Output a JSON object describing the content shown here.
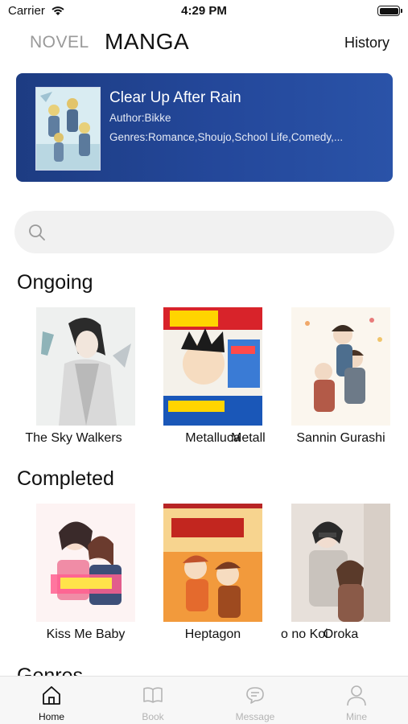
{
  "status_bar": {
    "carrier": "Carrier",
    "time": "4:29 PM"
  },
  "header": {
    "novel_tab": "NOVEL",
    "manga_tab": "MANGA",
    "history_label": "History"
  },
  "banner": {
    "title": "Clear Up After Rain",
    "author": "Author:Bikke",
    "genres": "Genres:Romance,Shoujo,School Life,Comedy,..."
  },
  "search": {
    "placeholder": ""
  },
  "ongoing": {
    "title": "Ongoing",
    "items": [
      {
        "label": "The Sky Walkers"
      },
      {
        "label": "Metalluca"
      },
      {
        "label": "Metall"
      },
      {
        "label": "Sannin Gurashi"
      }
    ]
  },
  "completed": {
    "title": "Completed",
    "items": [
      {
        "label": "Kiss Me Baby"
      },
      {
        "label": "Heptagon"
      },
      {
        "label": "o no Koi"
      },
      {
        "label": "Oroka"
      }
    ]
  },
  "next_section": {
    "title": "Genres"
  },
  "bottom_nav": {
    "items": [
      {
        "label": "Home",
        "icon": "home-icon",
        "active": true
      },
      {
        "label": "Book",
        "icon": "book-icon",
        "active": false
      },
      {
        "label": "Message",
        "icon": "message-icon",
        "active": false
      },
      {
        "label": "Mine",
        "icon": "user-icon",
        "active": false
      }
    ]
  },
  "colors": {
    "banner": "#24489b",
    "inactive_nav": "#b4b4b4",
    "search_bg": "#f1f1f1"
  }
}
